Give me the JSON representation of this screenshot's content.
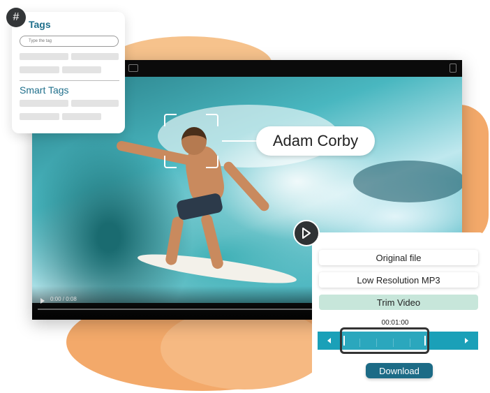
{
  "tags_panel": {
    "hash_symbol": "#",
    "title": "Tags",
    "input_placeholder": "Type the tag",
    "smart_tags_title": "Smart Tags"
  },
  "video": {
    "time_display": "0:00 / 0:08",
    "detected_person_name": "Adam Corby"
  },
  "download_panel": {
    "options": [
      "Original file",
      "Low Resolution MP3",
      "Trim Video"
    ],
    "selected_option": "Trim Video",
    "trim_timestamp": "00:01:00",
    "download_label": "Download"
  },
  "colors": {
    "accent": "#1f6f8b",
    "timeline": "#1aa0b8",
    "selected_option_bg": "#c7e6da",
    "download_button": "#1c6b86",
    "blob_orange": "#f3a96a"
  }
}
